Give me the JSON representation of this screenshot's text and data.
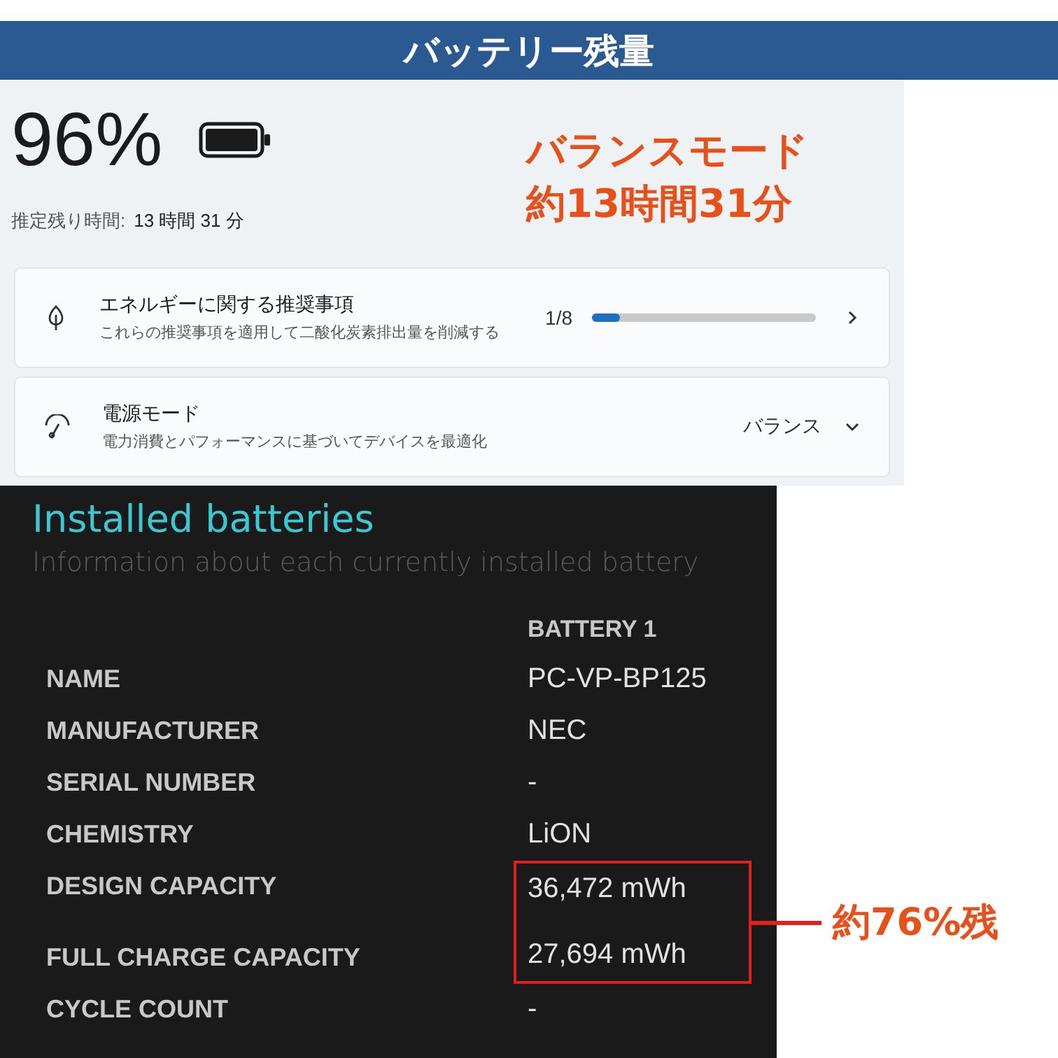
{
  "header": {
    "title": "バッテリー残量"
  },
  "settings": {
    "percent": "96%",
    "estimate_label": "推定残り時間:",
    "estimate_value": "13 時間 31 分",
    "cards": [
      {
        "kind": "progress",
        "title": "エネルギーに関する推奨事項",
        "subtitle": "これらの推奨事項を適用して二酸化炭素排出量を削減する",
        "reading": "1/8",
        "level": 0.125
      },
      {
        "kind": "dropdown",
        "title": "電源モード",
        "subtitle": "電力消費とパフォーマンスに基づいてデバイスを最適化",
        "value": "バランス"
      }
    ]
  },
  "top_callout": [
    "バランスモード",
    "約13時間31分"
  ],
  "report": {
    "title": "Installed batteries",
    "subtitle": "Information about each currently installed battery",
    "column_header": "BATTERY 1",
    "rows": [
      {
        "label": "NAME",
        "value": "PC-VP-BP125",
        "highlighted": false
      },
      {
        "label": "MANUFACTURER",
        "value": "NEC",
        "highlighted": false
      },
      {
        "label": "SERIAL NUMBER",
        "value": "-",
        "highlighted": false
      },
      {
        "label": "CHEMISTRY",
        "value": "LiON",
        "highlighted": false
      },
      {
        "label": "DESIGN CAPACITY",
        "value": "36,472 mWh",
        "highlighted": true
      },
      {
        "label": "FULL CHARGE CAPACITY",
        "value": "27,694 mWh",
        "highlighted": true
      },
      {
        "label": "CYCLE COUNT",
        "value": "-",
        "highlighted": false
      }
    ]
  },
  "bottom_callout": "約76%残"
}
